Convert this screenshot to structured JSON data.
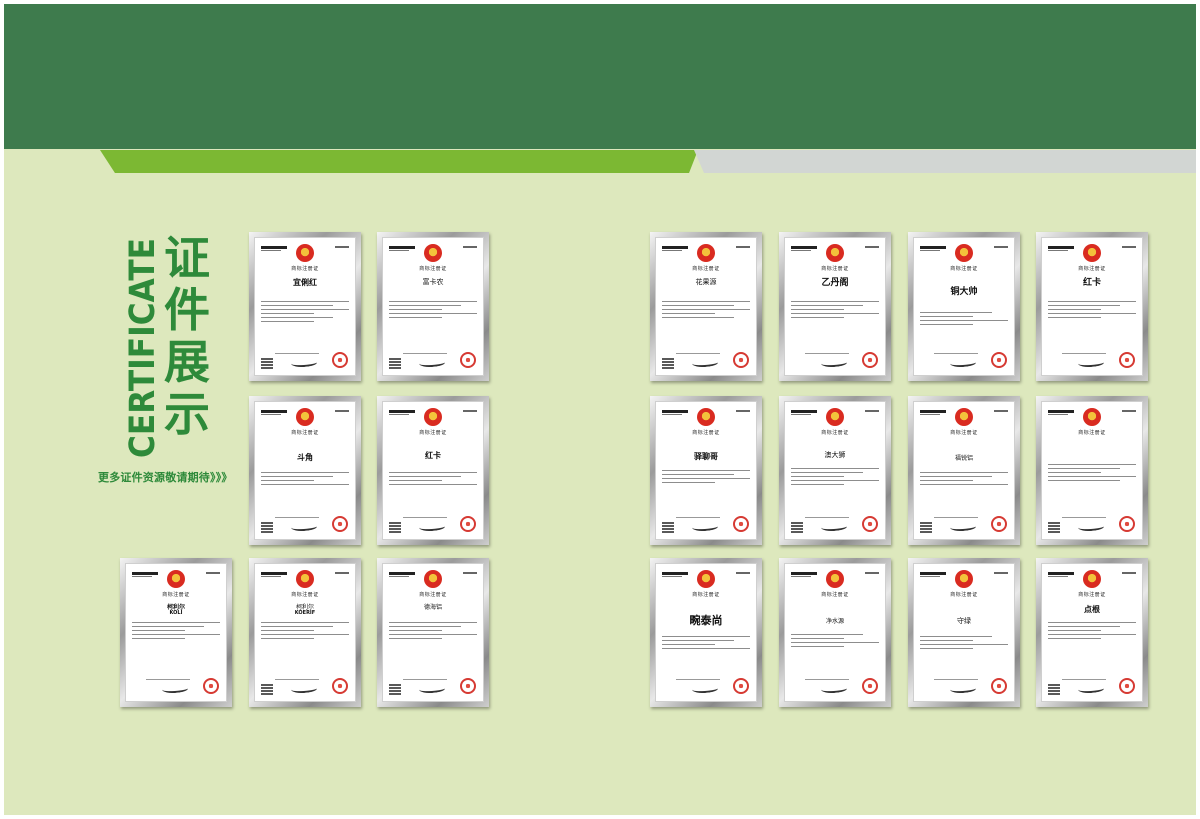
{
  "title": {
    "cn_chars": [
      "证",
      "件",
      "展",
      "示"
    ],
    "en": "CERTIFICATE",
    "more": "更多证件资源敬请期待》》》"
  },
  "certificate_heading": "商标注册证",
  "colors": {
    "header_green": "#3e7b4d",
    "stripe_green": "#7cb833",
    "stripe_gray": "#d2d6d3",
    "background": "#dde8bd",
    "title_green": "#2e8a3a",
    "seal_red": "#d63a33"
  },
  "certificates": [
    {
      "mark": "宜俐红",
      "sub": ""
    },
    {
      "mark": "富卡农",
      "sub": ""
    },
    {
      "mark": "花果源",
      "sub": ""
    },
    {
      "mark": "乙丹阁",
      "sub": ""
    },
    {
      "mark": "铜大帅",
      "sub": ""
    },
    {
      "mark": "红卡",
      "sub": ""
    },
    {
      "mark": "斗角",
      "sub": ""
    },
    {
      "mark": "红卡",
      "sub": ""
    },
    {
      "mark": "驿聊哥",
      "sub": ""
    },
    {
      "mark": "澳大狮",
      "sub": ""
    },
    {
      "mark": "福锐铝",
      "sub": ""
    },
    {
      "mark": "",
      "sub": ""
    },
    {
      "mark": "柯利尔",
      "sub": "KOLI"
    },
    {
      "mark": "柯利尔",
      "sub": "KOERIF"
    },
    {
      "mark": "德海铝",
      "sub": ""
    },
    {
      "mark": "畹泰尚",
      "sub": ""
    },
    {
      "mark": "净水源",
      "sub": ""
    },
    {
      "mark": "守绿",
      "sub": ""
    },
    {
      "mark": "点根",
      "sub": ""
    }
  ]
}
